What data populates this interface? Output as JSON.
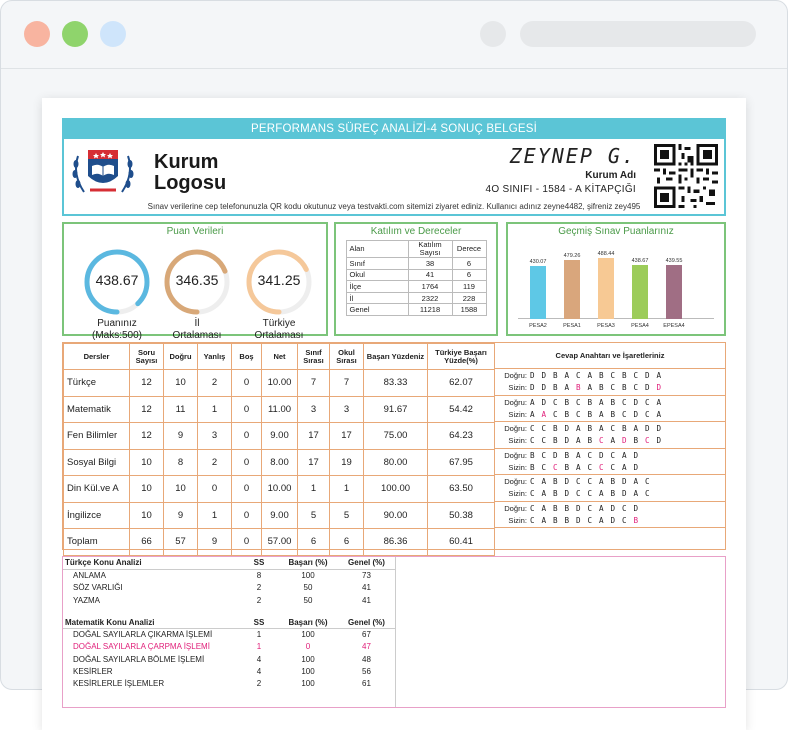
{
  "header": {
    "title": "PERFORMANS SÜREÇ ANALİZİ-4 SONUÇ BELGESİ",
    "logo_line1": "Kurum",
    "logo_line2": "Logosu",
    "student_name": "ZEYNEP G.",
    "institution": "Kurum Adı",
    "class_line": "4O SINIFI  -  1584  -   A KİTAPÇIĞI",
    "info": "Sınav verilerine cep telefonunuzla QR kodu okutunuz veya testvakti.com sitemizi ziyaret ediniz. Kullanıcı adınız zeyne4482, şifreniz zey495"
  },
  "scores": {
    "title": "Puan Verileri",
    "gauges": [
      {
        "value": "438.67",
        "label1": "Puanınız",
        "label2": "(Maks:500)",
        "fraction": 0.877,
        "color": "#5bb8e0"
      },
      {
        "value": "346.35",
        "label1": "İl",
        "label2": "Ortalaması",
        "fraction": 0.69,
        "color": "#d8a878"
      },
      {
        "value": "341.25",
        "label1": "Türkiye",
        "label2": "Ortalaması",
        "fraction": 0.68,
        "color": "#f5c89a"
      }
    ]
  },
  "participation": {
    "title": "Katılım ve Dereceler",
    "headers": [
      "Alan",
      "Katılım Sayısı",
      "Derece"
    ],
    "rows": [
      [
        "Sınıf",
        "38",
        "6"
      ],
      [
        "Okul",
        "41",
        "6"
      ],
      [
        "İlçe",
        "1764",
        "119"
      ],
      [
        "İl",
        "2322",
        "228"
      ],
      [
        "Genel",
        "11218",
        "1588"
      ]
    ]
  },
  "history": {
    "title": "Geçmiş Sınav Puanlarınız",
    "chart_data": {
      "type": "bar",
      "categories": [
        "PESA2",
        "PESA1",
        "PESA3",
        "PESA4",
        "EPESA4"
      ],
      "values": [
        430.07,
        479.26,
        488.44,
        438.67,
        439.55
      ],
      "colors": [
        "#5ec8e6",
        "#d9a67c",
        "#f7c994",
        "#9ccc5a",
        "#a06e84"
      ],
      "ylim": [
        0,
        500
      ]
    }
  },
  "results": {
    "headers": [
      "Dersler",
      "Soru Sayısı",
      "Doğru",
      "Yanlış",
      "Boş",
      "Net",
      "Sınıf Sırası",
      "Okul Sırası",
      "Başarı Yüzdeniz",
      "Türkiye Başarı Yüzde(%)"
    ],
    "rows": [
      [
        "Türkçe",
        "12",
        "10",
        "2",
        "0",
        "10.00",
        "7",
        "7",
        "83.33",
        "62.07"
      ],
      [
        "Matematik",
        "12",
        "11",
        "1",
        "0",
        "11.00",
        "3",
        "3",
        "91.67",
        "54.42"
      ],
      [
        "Fen Bilimler",
        "12",
        "9",
        "3",
        "0",
        "9.00",
        "17",
        "17",
        "75.00",
        "64.23"
      ],
      [
        "Sosyal Bilgi",
        "10",
        "8",
        "2",
        "0",
        "8.00",
        "17",
        "19",
        "80.00",
        "67.95"
      ],
      [
        "Din Kül.ve A",
        "10",
        "10",
        "0",
        "0",
        "10.00",
        "1",
        "1",
        "100.00",
        "63.50"
      ],
      [
        "İngilizce",
        "10",
        "9",
        "1",
        "0",
        "9.00",
        "5",
        "5",
        "90.00",
        "50.38"
      ],
      [
        "Toplam",
        "66",
        "57",
        "9",
        "0",
        "57.00",
        "6",
        "6",
        "86.36",
        "60.41"
      ]
    ],
    "answers_title": "Cevap Anahtarı ve İşaretleriniz",
    "correct_label": "Doğru:",
    "yours_label": "Sizin:",
    "answers": [
      {
        "correct": [
          "D",
          "D",
          "B",
          "A",
          "C",
          "A",
          "B",
          "C",
          "B",
          "C",
          "D",
          "A"
        ],
        "yours": [
          "D",
          "D",
          "B",
          "A",
          "B",
          "A",
          "B",
          "C",
          "B",
          "C",
          "D",
          "D"
        ],
        "wrong": [
          4,
          11
        ]
      },
      {
        "correct": [
          "A",
          "D",
          "C",
          "B",
          "C",
          "B",
          "A",
          "B",
          "C",
          "D",
          "C",
          "A"
        ],
        "yours": [
          "A",
          "A",
          "C",
          "B",
          "C",
          "B",
          "A",
          "B",
          "C",
          "D",
          "C",
          "A"
        ],
        "wrong": [
          1
        ]
      },
      {
        "correct": [
          "C",
          "C",
          "B",
          "D",
          "A",
          "B",
          "A",
          "C",
          "B",
          "A",
          "D",
          "D"
        ],
        "yours": [
          "C",
          "C",
          "B",
          "D",
          "A",
          "B",
          "C",
          "A",
          "D",
          "B",
          "C",
          "D"
        ],
        "wrong": [
          6,
          8,
          10
        ]
      },
      {
        "correct": [
          "B",
          "C",
          "D",
          "B",
          "A",
          "C",
          "D",
          "C",
          "A",
          "D"
        ],
        "yours": [
          "B",
          "C",
          "C",
          "B",
          "A",
          "C",
          "C",
          "C",
          "A",
          "D"
        ],
        "wrong": [
          2,
          6
        ]
      },
      {
        "correct": [
          "C",
          "A",
          "B",
          "D",
          "C",
          "C",
          "A",
          "B",
          "D",
          "A",
          "C"
        ],
        "yours": [
          "C",
          "A",
          "B",
          "D",
          "C",
          "C",
          "A",
          "B",
          "D",
          "A",
          "C"
        ],
        "wrong": []
      },
      {
        "correct": [
          "C",
          "A",
          "B",
          "B",
          "D",
          "C",
          "A",
          "D",
          "C",
          "D"
        ],
        "yours": [
          "C",
          "A",
          "B",
          "B",
          "D",
          "C",
          "A",
          "D",
          "C",
          "B"
        ],
        "wrong": [
          9
        ]
      }
    ]
  },
  "topics": {
    "sections": [
      {
        "title": "Türkçe Konu Analizi",
        "col_ss": "SS",
        "col_basari": "Başarı (%)",
        "col_genel": "Genel (%)",
        "rows": [
          {
            "name": "ANLAMA",
            "ss": "8",
            "basari": "100",
            "genel": "73",
            "highlight": false
          },
          {
            "name": "SÖZ VARLIĞI",
            "ss": "2",
            "basari": "50",
            "genel": "41",
            "highlight": false
          },
          {
            "name": "YAZMA",
            "ss": "2",
            "basari": "50",
            "genel": "41",
            "highlight": false
          }
        ]
      },
      {
        "title": "Matematik Konu Analizi",
        "col_ss": "SS",
        "col_basari": "Başarı (%)",
        "col_genel": "Genel (%)",
        "rows": [
          {
            "name": "DOĞAL SAYILARLA ÇIKARMA İŞLEMİ",
            "ss": "1",
            "basari": "100",
            "genel": "67",
            "highlight": false
          },
          {
            "name": "DOĞAL SAYILARLA ÇARPMA İŞLEMİ",
            "ss": "1",
            "basari": "0",
            "genel": "47",
            "highlight": true
          },
          {
            "name": "DOĞAL SAYILARLA BÖLME İŞLEMİ",
            "ss": "4",
            "basari": "100",
            "genel": "48",
            "highlight": false
          },
          {
            "name": "KESİRLER",
            "ss": "4",
            "basari": "100",
            "genel": "56",
            "highlight": false
          },
          {
            "name": "KESİRLERLE İŞLEMLER",
            "ss": "2",
            "basari": "100",
            "genel": "61",
            "highlight": false
          }
        ]
      }
    ]
  }
}
